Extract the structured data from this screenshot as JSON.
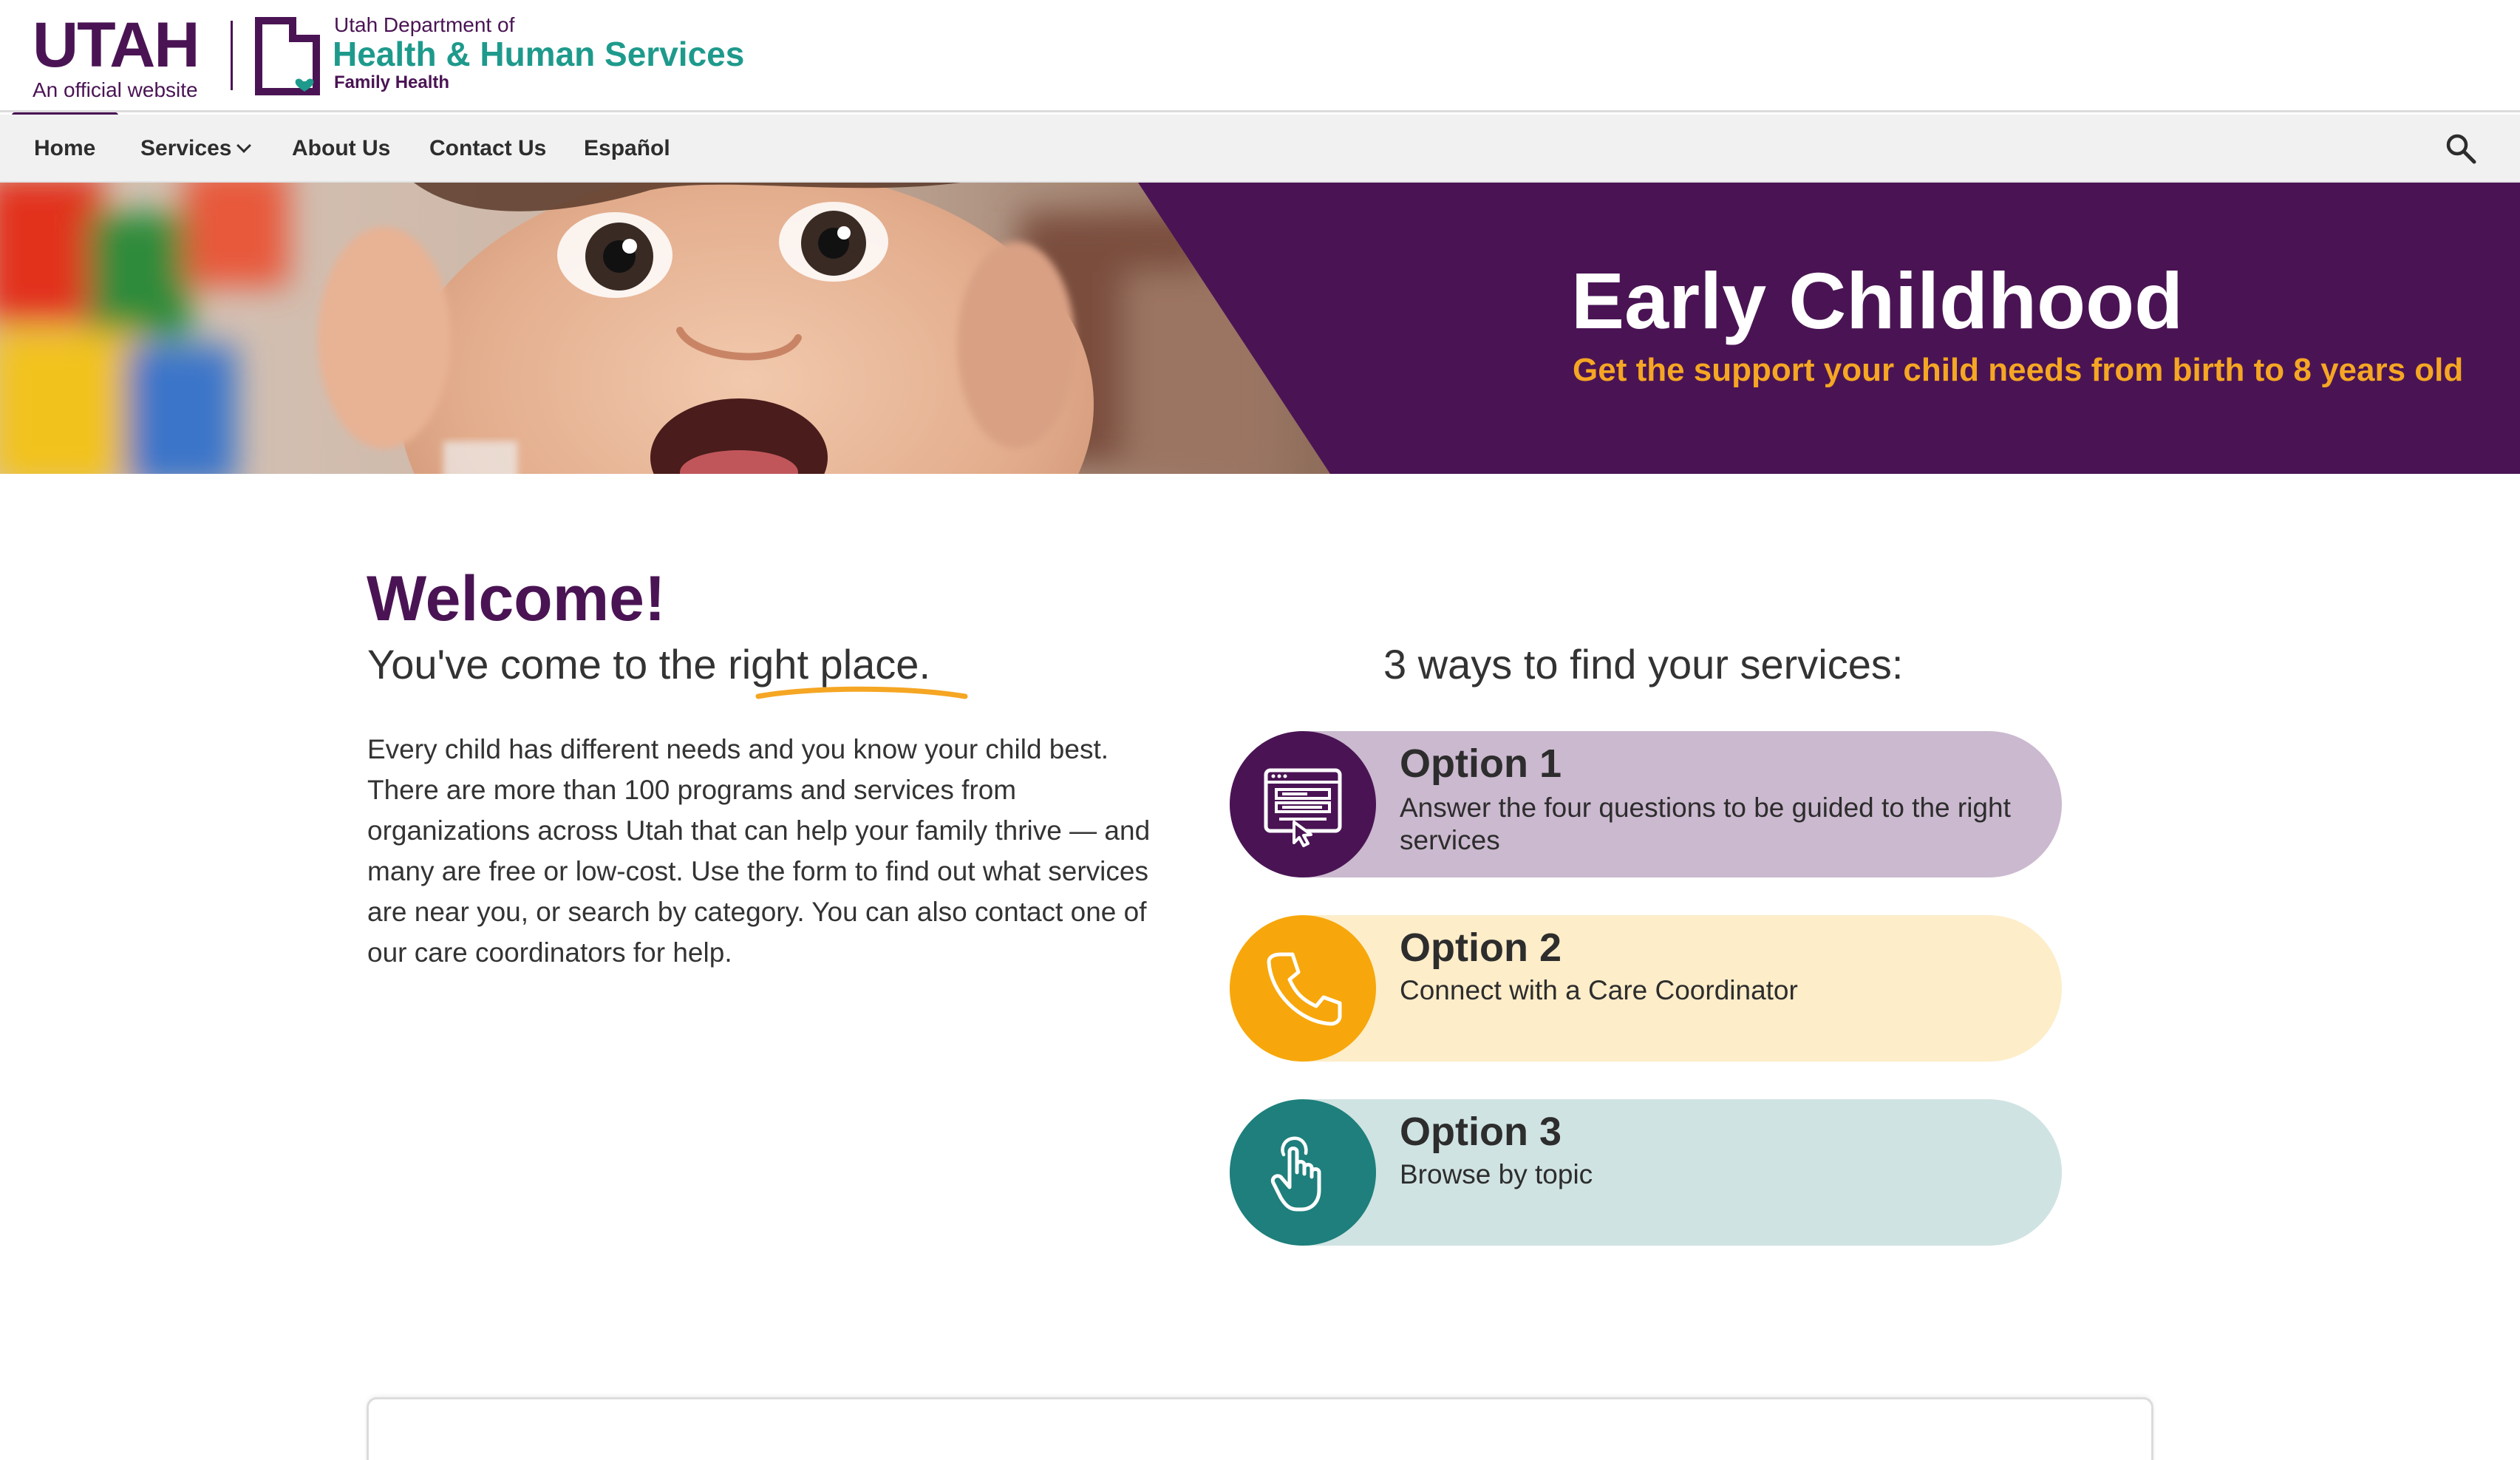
{
  "header": {
    "utah_logo_text": "UTAH",
    "utah_tagline": "An official website",
    "dept_prefix": "Utah Department of",
    "dept_name": "Health & Human Services",
    "dept_division": "Family Health",
    "brand_purple": "#4a1454",
    "brand_teal": "#1e9a8c"
  },
  "nav": {
    "items": [
      {
        "label": "Home",
        "active": true
      },
      {
        "label": "Services",
        "has_dropdown": true
      },
      {
        "label": "About Us"
      },
      {
        "label": "Contact Us"
      },
      {
        "label": "Español"
      }
    ],
    "search_icon": "search-icon"
  },
  "hero": {
    "title": "Early Childhood",
    "subtitle": "Get the support your child needs from birth to 8 years old",
    "image": "photo of a baby looking at the camera",
    "accent_color": "#f5a623"
  },
  "welcome": {
    "heading": "Welcome!",
    "sub_prefix": "You've come to the ",
    "sub_highlight": "right place",
    "sub_suffix": ".",
    "body": "Every child has different needs and you know your child best. There are more than 100 programs and services from organizations across Utah that can help your family thrive — and many are free or low-cost. Use the form to find out what services are near you, or search by category. You can also contact one of our care coordinators for help."
  },
  "options": {
    "heading": "3 ways to find your services:",
    "items": [
      {
        "title": "Option 1",
        "description": "Answer the four questions to be guided to the right services",
        "icon": "web-form-icon",
        "color": "#4a1454"
      },
      {
        "title": "Option 2",
        "description": "Connect with a Care Coordinator",
        "icon": "phone-icon",
        "color": "#f7a70b"
      },
      {
        "title": "Option 3",
        "description": "Browse by topic",
        "icon": "pointing-hand-icon",
        "color": "#1e7f7c"
      }
    ]
  }
}
